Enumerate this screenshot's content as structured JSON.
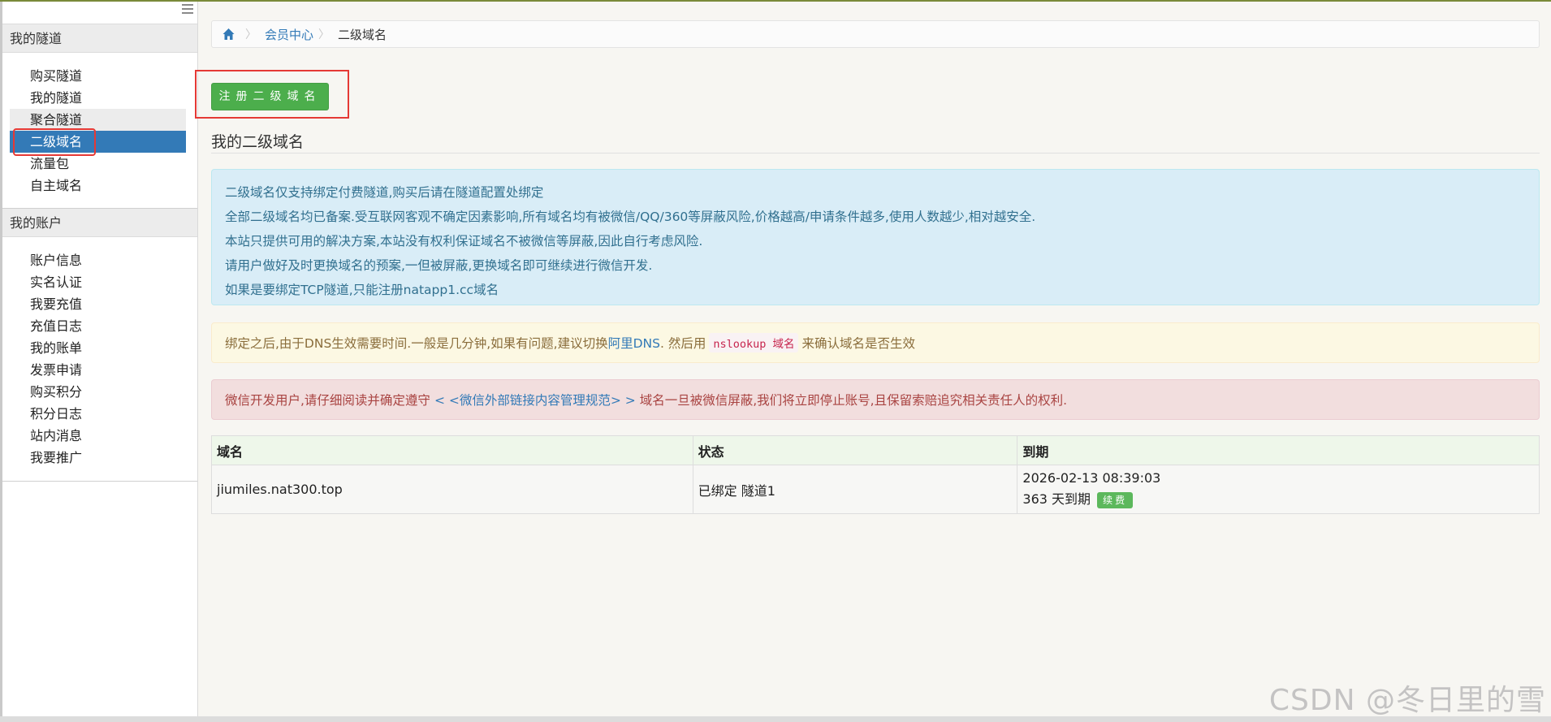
{
  "sidebar": {
    "section_tunnels": "我的隧道",
    "tunnel_items": [
      "购买隧道",
      "我的隧道",
      "聚合隧道",
      "二级域名",
      "流量包",
      "自主域名"
    ],
    "section_account": "我的账户",
    "account_items": [
      "账户信息",
      "实名认证",
      "我要充值",
      "充值日志",
      "我的账单",
      "发票申请",
      "购买积分",
      "积分日志",
      "站内消息",
      "我要推广"
    ]
  },
  "breadcrumb": {
    "parent": "会员中心",
    "current": "二级域名"
  },
  "register_label": "注册二级域名",
  "section_title": "我的二级域名",
  "info_lines": [
    "二级域名仅支持绑定付费隧道,购买后请在隧道配置处绑定",
    "全部二级域名均已备案.受互联网客观不确定因素影响,所有域名均有被微信/QQ/360等屏蔽风险,价格越高/申请条件越多,使用人数越少,相对越安全.",
    "本站只提供可用的解决方案,本站没有权利保证域名不被微信等屏蔽,因此自行考虑风险.",
    "请用户做好及时更换域名的预案,一但被屏蔽,更换域名即可继续进行微信开发.",
    "如果是要绑定TCP隧道,只能注册natapp1.cc域名"
  ],
  "warn": {
    "before": "绑定之后,由于DNS生效需要时间.一般是几分钟,如果有问题,建议切换",
    "link": "阿里DNS",
    "middle": ". 然后用",
    "code": "nslookup 域名",
    "after": "来确认域名是否生效"
  },
  "danger": {
    "before": "微信开发用户,请仔细阅读并确定遵守",
    "link": "< <微信外部链接内容管理规范> >",
    "after": "域名一旦被微信屏蔽,我们将立即停止账号,且保留索赔追究相关责任人的权利."
  },
  "table": {
    "headers": [
      "域名",
      "状态",
      "到期"
    ],
    "rows": [
      {
        "domain": "jiumiles.nat300.top",
        "status": "已绑定 隧道1",
        "expire_time": "2026-02-13 08:39:03",
        "days_left": "363 天到期",
        "renew": "续费"
      }
    ]
  },
  "watermark": "CSDN @冬日里的雪",
  "colors": {
    "primary": "#337ab7",
    "success": "#4cae4c",
    "highlight": "#e53935"
  }
}
